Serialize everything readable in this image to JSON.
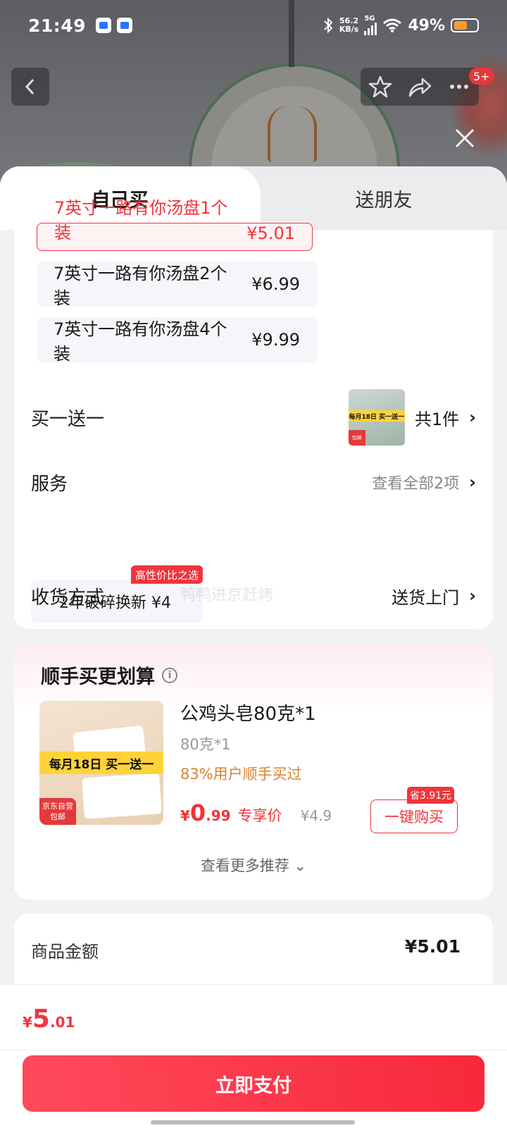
{
  "status_bar": {
    "time": "21:49",
    "net_speed_value": "56.2",
    "net_speed_unit": "KB/s",
    "network_type": "5G",
    "battery": "49%"
  },
  "nav": {
    "badge": "5+"
  },
  "tabs": {
    "self": "自己买",
    "friend": "送朋友"
  },
  "variants": [
    {
      "name": "7英寸一路有你汤盘1个装",
      "price": "¥5.01",
      "selected": true
    },
    {
      "name": "7英寸一路有你汤盘2个装",
      "price": "¥6.99",
      "selected": false
    },
    {
      "name": "7英寸一路有你汤盘4个装",
      "price": "¥9.99",
      "selected": false
    }
  ],
  "bogo": {
    "label": "买一送一",
    "count": "共1件",
    "thumb_banner": "每月18日 买一送一",
    "thumb_tag": "包邮"
  },
  "service": {
    "label": "服务",
    "view_all": "查看全部2项",
    "chip": "2年破碎换新  ¥4",
    "chip_tag": "高性价比之选"
  },
  "watermark": "鸭鸭进京赶烤",
  "delivery": {
    "label": "收货方式",
    "value": "送货上门"
  },
  "recommend": {
    "title": "顺手买更划算",
    "product_name": "公鸡头皂80克*1",
    "spec": "80克*1",
    "bought": "83%用户顺手买过",
    "price_currency": "¥",
    "price_int": "0",
    "price_dec": ".99",
    "exclusive": "专享价",
    "original_price": "¥4.9",
    "save_tag": "省3.91元",
    "buy_button": "一键购买",
    "img_banner": "每月18日 买一送一",
    "img_tag_line1": "京东自营",
    "img_tag_line2": "包邮",
    "more": "查看更多推荐"
  },
  "amount": {
    "label": "商品金额",
    "value": "¥5.01"
  },
  "bottom": {
    "currency": "¥",
    "int": "5",
    "dec": ".01",
    "pay_button": "立即支付"
  }
}
